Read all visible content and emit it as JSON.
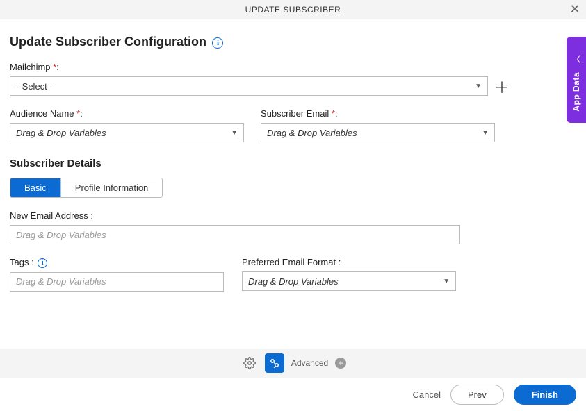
{
  "title": "UPDATE SUBSCRIBER",
  "heading": "Update Subscriber Configuration",
  "side_tab": "App Data",
  "labels": {
    "mailchimp": "Mailchimp ",
    "audience": "Audience Name ",
    "sub_email": "Subscriber Email ",
    "sub_details": "Subscriber Details",
    "new_email": "New Email Address :",
    "tags": "Tags :",
    "pref_format": "Preferred Email Format :"
  },
  "req": "*",
  "colon": ":",
  "selects": {
    "mailchimp_value": "--Select--",
    "placeholder": "Drag & Drop Variables"
  },
  "tabs": {
    "basic": "Basic",
    "profile": "Profile Information"
  },
  "footer": {
    "advanced": "Advanced",
    "cancel": "Cancel",
    "prev": "Prev",
    "finish": "Finish"
  }
}
